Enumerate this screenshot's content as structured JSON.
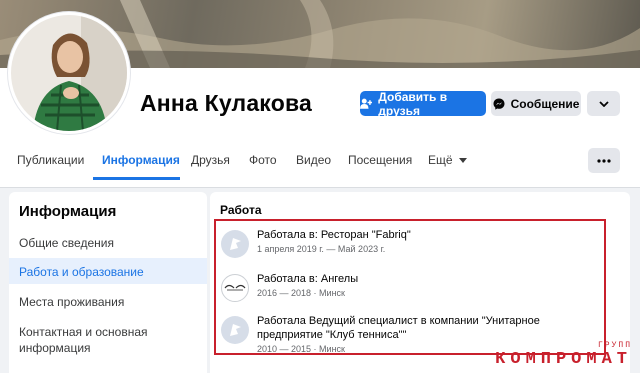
{
  "profile": {
    "name": "Анна Кулакова",
    "add_friend_label": "Добавить в друзья",
    "message_label": "Сообщение"
  },
  "tabs": [
    {
      "label": "Публикации"
    },
    {
      "label": "Информация"
    },
    {
      "label": "Друзья"
    },
    {
      "label": "Фото"
    },
    {
      "label": "Видео"
    },
    {
      "label": "Посещения"
    },
    {
      "label": "Ещё"
    }
  ],
  "sidebar": {
    "title": "Информация",
    "items": [
      {
        "label": "Общие сведения"
      },
      {
        "label": "Работа и образование"
      },
      {
        "label": "Места проживания"
      },
      {
        "label": "Контактная и основная информация"
      }
    ]
  },
  "work": {
    "title": "Работа",
    "jobs": [
      {
        "prefix": "Работала в: ",
        "place": "Ресторан \"Fabriq\"",
        "meta": "1 апреля 2019 г. — Май 2023 г."
      },
      {
        "prefix": "Работала в: ",
        "place": "Ангелы",
        "meta": "2016 — 2018 · Минск"
      },
      {
        "prefix": "Работала Ведущий специалист в компании ",
        "place": "\"Унитарное предприятие \"Клуб тенниса\"\"",
        "meta": "2010 — 2015 · Минск"
      }
    ]
  },
  "watermark": {
    "small": "ГРУПП",
    "big": "КОМПРОМАТ"
  },
  "colors": {
    "accent": "#1b74e4",
    "highlight_frame": "#c8202c"
  },
  "icons": {
    "add_friend": "person-plus-icon",
    "message": "messenger-icon",
    "more": "chevron-down-icon",
    "options": "more-dots-icon",
    "job": "briefcase-flag-icon"
  }
}
